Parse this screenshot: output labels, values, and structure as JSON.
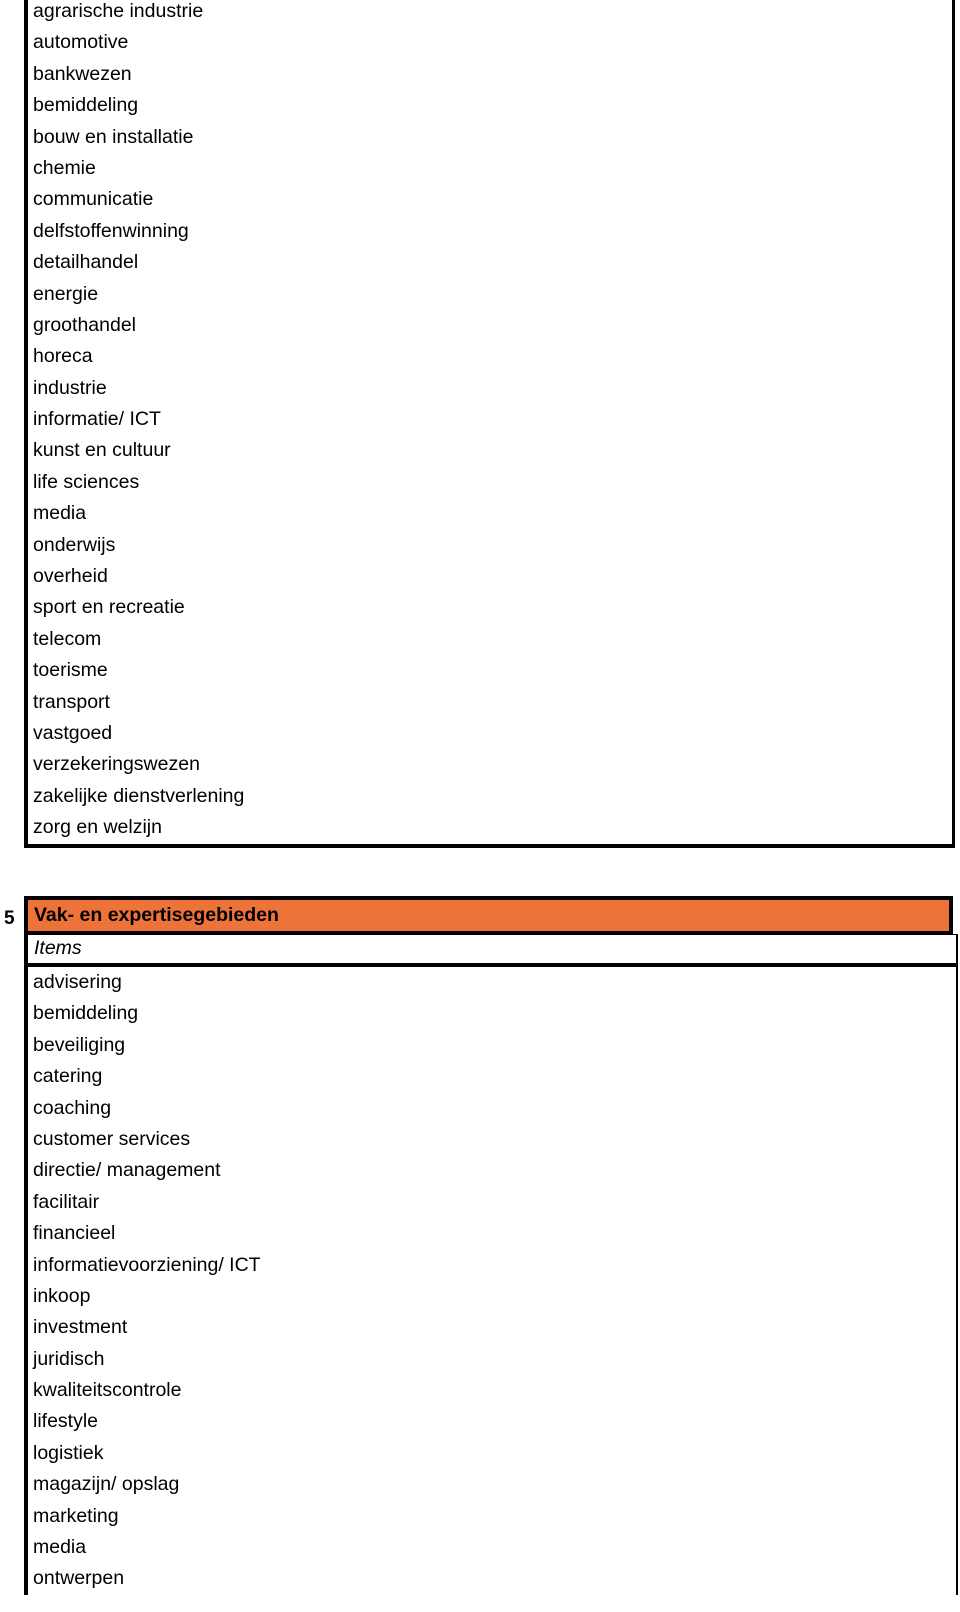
{
  "document": {
    "type": "form-table-list",
    "accent_color": "#ed7338",
    "border_color": "#000000",
    "background_color": "#ffffff"
  },
  "continued_section": {
    "note": "continuation of previous branche list, clipped at top of page",
    "items": [
      "agrarische industrie",
      "automotive",
      "bankwezen",
      "bemiddeling",
      "bouw en installatie",
      "chemie",
      "communicatie",
      "delfstoffenwinning",
      "detailhandel",
      "energie",
      "groothandel",
      "horeca",
      "industrie",
      "informatie/ ICT",
      "kunst en cultuur",
      "life sciences",
      "media",
      "onderwijs",
      "overheid",
      "sport en recreatie",
      "telecom",
      "toerisme",
      "transport",
      "vastgoed",
      "verzekeringswezen",
      "zakelijke dienstverlening",
      "zorg en welzijn"
    ]
  },
  "section_five": {
    "number": "5",
    "title": "Vak- en expertisegebieden",
    "column_header": "Items",
    "items": [
      "advisering",
      "bemiddeling",
      "beveiliging",
      "catering",
      "coaching",
      "customer services",
      "directie/ management",
      "facilitair",
      "financieel",
      "informatievoorziening/ ICT",
      "inkoop",
      "investment",
      "juridisch",
      "kwaliteitscontrole",
      "lifestyle",
      "logistiek",
      "magazijn/ opslag",
      "marketing",
      "media",
      "ontwerpen"
    ]
  }
}
